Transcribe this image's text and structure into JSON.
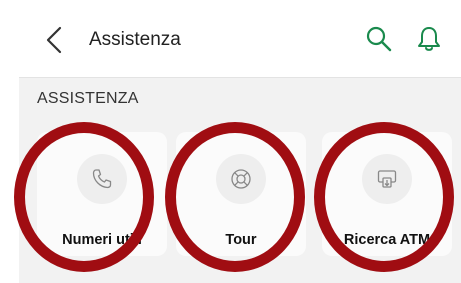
{
  "header": {
    "title": "Assistenza",
    "icons": [
      "back-chevron-icon",
      "search-icon",
      "bell-icon"
    ],
    "accent_color": "#1a8a4d"
  },
  "section": {
    "title": "ASSISTENZA"
  },
  "cards": [
    {
      "label": "Numeri utili",
      "icon": "phone-icon"
    },
    {
      "label": "Tour",
      "icon": "lifebuoy-icon"
    },
    {
      "label": "Ricerca ATM",
      "icon": "atm-icon"
    }
  ],
  "annotation_color": "#a00d12"
}
